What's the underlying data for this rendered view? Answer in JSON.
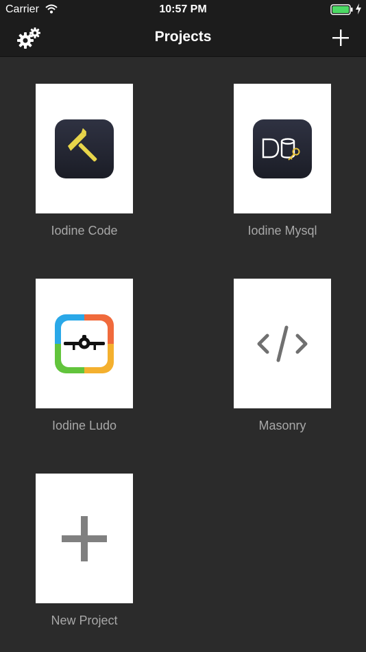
{
  "status_bar": {
    "carrier": "Carrier",
    "time": "10:57 PM"
  },
  "nav": {
    "title": "Projects",
    "settings_icon": "gears-icon",
    "add_icon": "plus-icon"
  },
  "projects": [
    {
      "label": "Iodine Code",
      "icon": "hammer-icon"
    },
    {
      "label": "Iodine Mysql",
      "icon": "database-key-icon"
    },
    {
      "label": "Iodine Ludo",
      "icon": "airplane-icon"
    },
    {
      "label": "Masonry",
      "icon": "code-icon"
    },
    {
      "label": "New Project",
      "icon": "plus-icon"
    }
  ],
  "colors": {
    "background": "#2b2b2b",
    "bar": "#1c1c1c",
    "label": "#a8a8a8",
    "battery": "#4cd964"
  }
}
